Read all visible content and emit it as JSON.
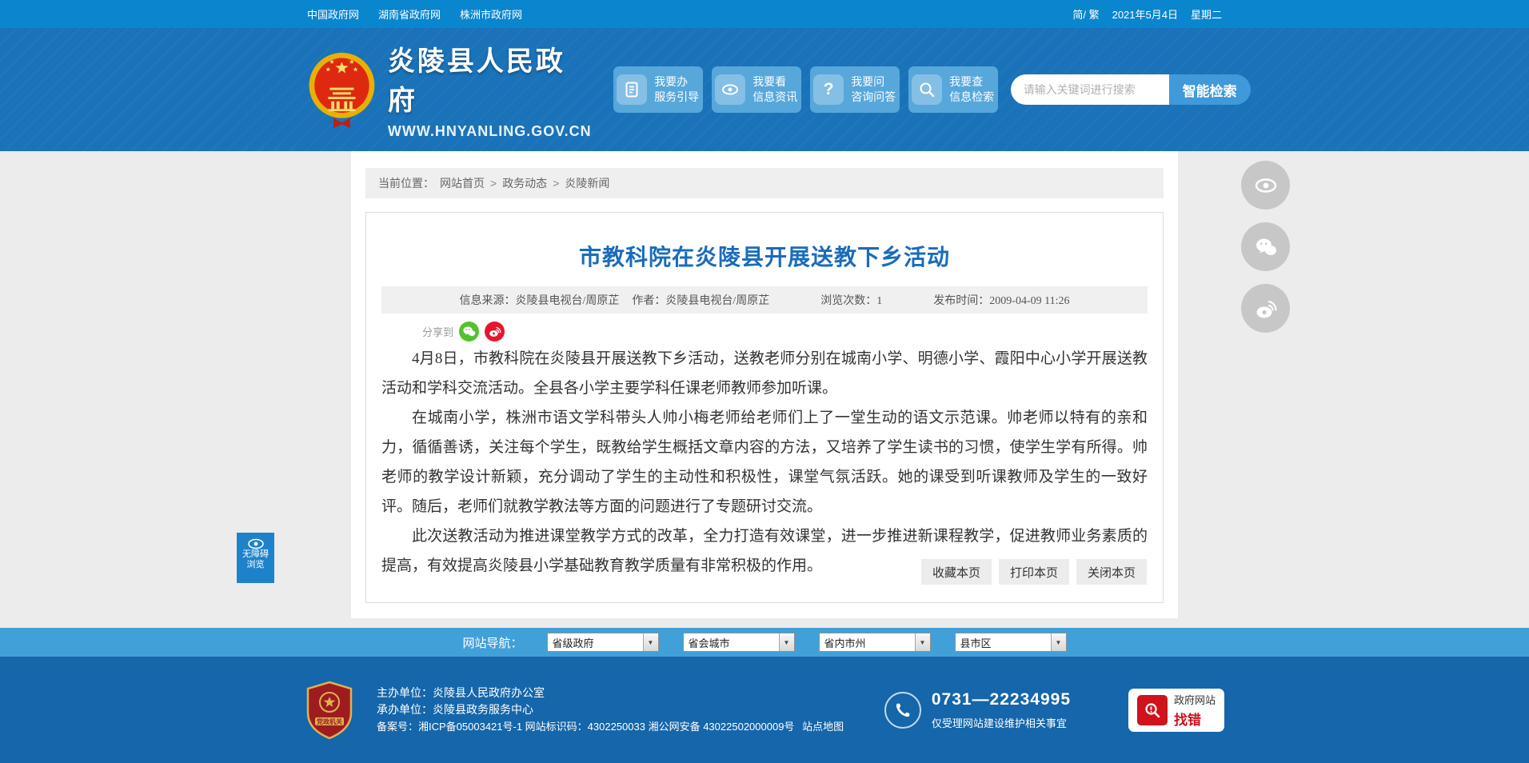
{
  "topbar": {
    "links": [
      "中国政府网",
      "湖南省政府网",
      "株洲市政府网"
    ],
    "lang": "简/ 繁",
    "date": "2021年5月4日",
    "weekday": "星期二"
  },
  "header": {
    "site_name": "炎陵县人民政府",
    "site_url": "WWW.HNYANLING.GOV.CN",
    "quick_buttons": [
      {
        "icon": "document-icon",
        "line1": "我要办",
        "line2": "服务引导"
      },
      {
        "icon": "eye-icon",
        "line1": "我要看",
        "line2": "信息资讯"
      },
      {
        "icon": "question-icon",
        "line1": "我要问",
        "line2": "咨询问答"
      },
      {
        "icon": "search-icon",
        "line1": "我要查",
        "line2": "信息检索"
      }
    ],
    "search": {
      "placeholder": "请输入关键词进行搜索",
      "button": "智能检索"
    }
  },
  "breadcrumb": {
    "label": "当前位置：",
    "separator": ">",
    "items": [
      "网站首页",
      "政务动态",
      "炎陵新闻"
    ]
  },
  "article": {
    "title": "市教科院在炎陵县开展送教下乡活动",
    "meta": {
      "source_label": "信息来源：",
      "source": "炎陵县电视台/周原芷",
      "author_label": "作者：",
      "author": "炎陵县电视台/周原芷",
      "views_label": "浏览次数：",
      "views": "1",
      "time_label": "发布时间：",
      "time": "2009-04-09 11:26"
    },
    "share_label": "分享到",
    "share_icons": [
      "wechat-icon",
      "weibo-icon"
    ],
    "paragraphs": [
      "4月8日，市教科院在炎陵县开展送教下乡活动，送教老师分别在城南小学、明德小学、霞阳中心小学开展送教活动和学科交流活动。全县各小学主要学科任课老师教师参加听课。",
      "在城南小学，株洲市语文学科带头人帅小梅老师给老师们上了一堂生动的语文示范课。帅老师以特有的亲和力，循循善诱，关注每个学生，既教给学生概括文章内容的方法，又培养了学生读书的习惯，使学生学有所得。帅老师的教学设计新颖，充分调动了学生的主动性和积极性，课堂气氛活跃。她的课受到听课教师及学生的一致好评。随后，老师们就教学教法等方面的问题进行了专题研讨交流。",
      "此次送教活动为推进课堂教学方式的改革，全力打造有效课堂，进一步推进新课程教学，促进教师业务素质的提高，有效提高炎陵县小学基础教育教学质量有非常积极的作用。"
    ],
    "actions": [
      "收藏本页",
      "打印本页",
      "关闭本页"
    ]
  },
  "nav_strip": {
    "label": "网站导航：",
    "selects": [
      "省级政府",
      "省会城市",
      "省内市州",
      "县市区"
    ]
  },
  "footer": {
    "organizer_label": "主办单位：",
    "organizer": "炎陵县人民政府办公室",
    "undertaker_label": "承办单位：",
    "undertaker": "炎陵县政务服务中心",
    "icp": "备案号：湘ICP备05003421号-1 网站标识码：4302250033 湘公网安备 43022502000009号",
    "sitemap": "站点地图",
    "phone": "0731—22234995",
    "phone_note": "仅受理网站建设维护相关事宜",
    "badge_line1": "政府网站",
    "badge_line2": "找错"
  },
  "accessibility": {
    "lines": [
      "无障碍",
      "浏览"
    ]
  },
  "float_menu": {
    "icons": [
      "eye-icon",
      "wechat-icon",
      "weibo-icon"
    ]
  },
  "colors": {
    "topbar_blue": "#0a86ce",
    "header_blue": "#1a72b9",
    "strip_blue": "#42a0d9",
    "footer_blue": "#1566aa",
    "title_blue": "#1b6cba",
    "wechat_green": "#53c22b",
    "weibo_red": "#e6162d",
    "error_red": "#d0121b"
  }
}
